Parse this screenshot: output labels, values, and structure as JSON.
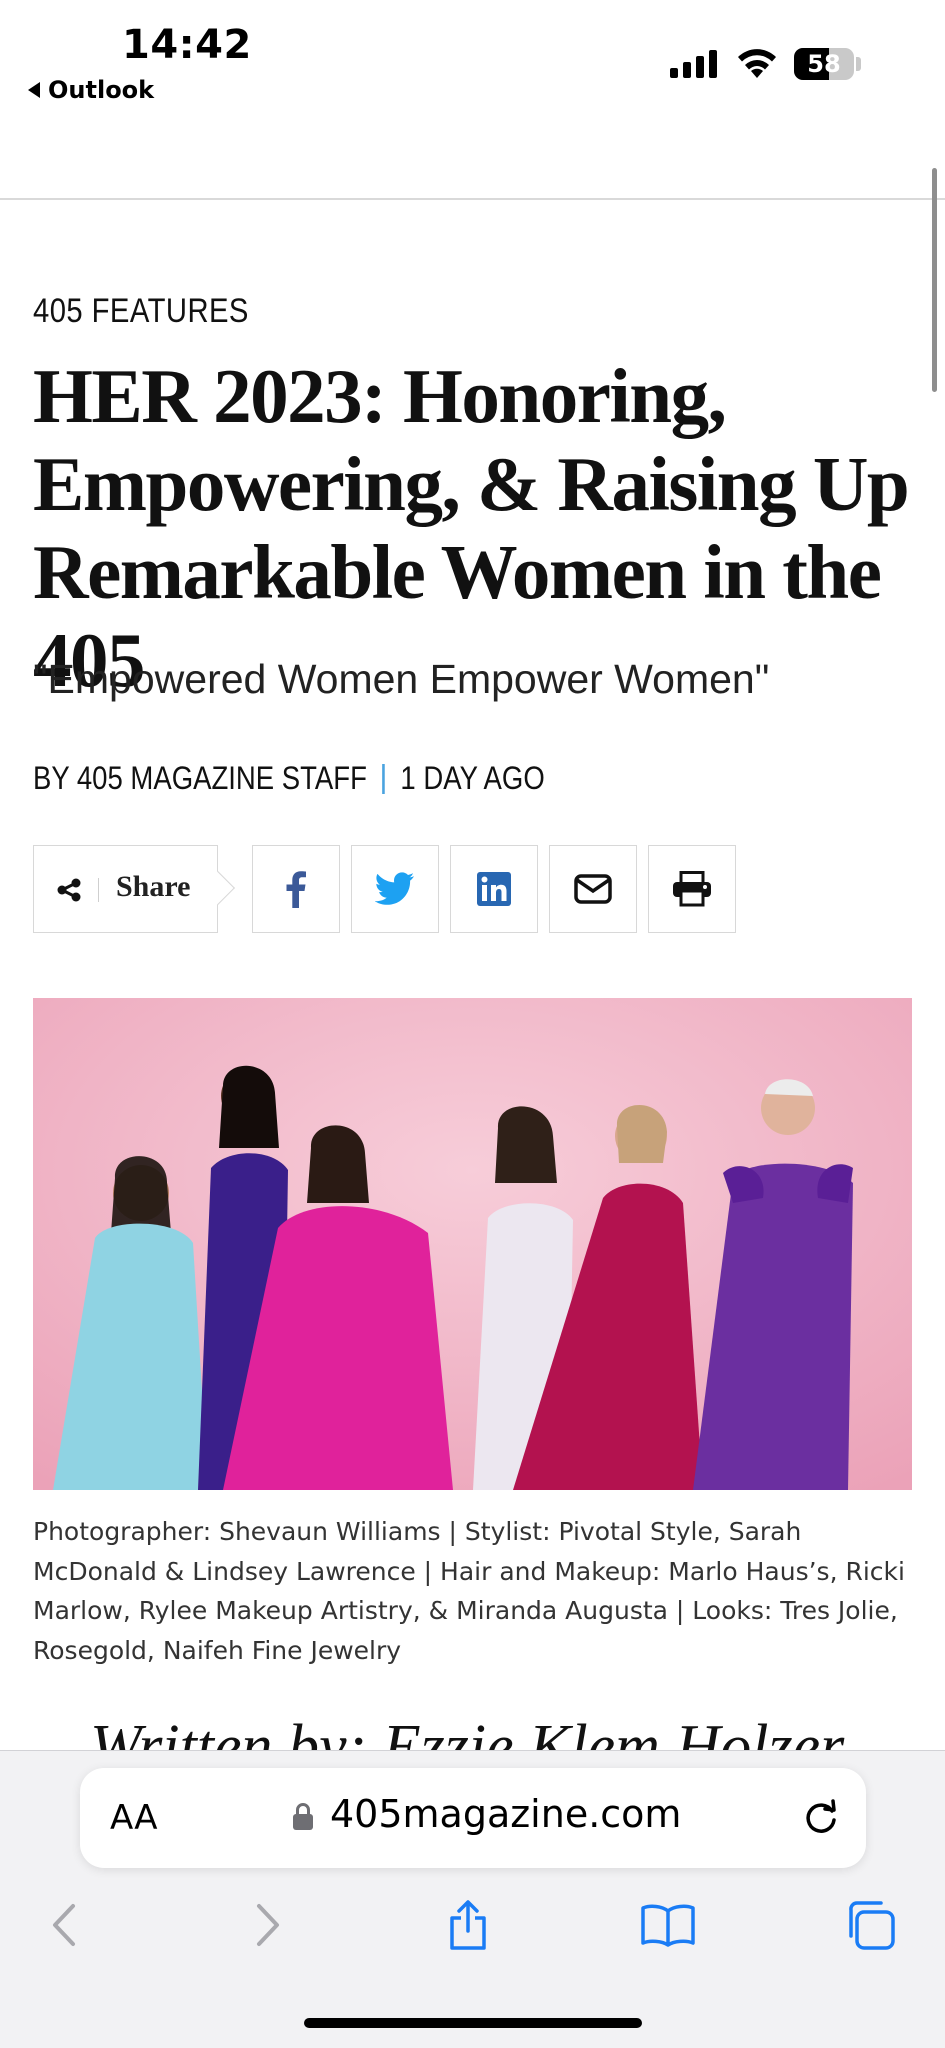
{
  "status_bar": {
    "time": "14:42",
    "back_app": "Outlook",
    "battery_percent": "58",
    "battery_level": 0.58
  },
  "article": {
    "category": "405 FEATURES",
    "headline_lines": [
      "HER 2023: Honoring,",
      "Empowering, & Raising Up",
      "Remarkable Women in the 405"
    ],
    "subtitle": "\"Empowered Women Empower Women\"",
    "byline": "BY 405 MAGAZINE STAFF",
    "date": "1 DAY AGO",
    "caption": "Photographer: Shevaun Williams | Stylist: Pivotal Style, Sarah McDonald & Lindsey Lawrence | Hair and Makeup: Marlo Haus’s, Ricki Marlow, Rylee Makeup Artistry, & Miranda Augusta | Looks: Tres Jolie, Rosegold, Naifeh Fine Jewelry",
    "written_by": "Written by: Ezzie Klem Holzer"
  },
  "share": {
    "label": "Share",
    "buttons": [
      {
        "name": "facebook",
        "icon": "facebook-icon",
        "color": "#3b5998"
      },
      {
        "name": "twitter",
        "icon": "twitter-icon",
        "color": "#1da1f2"
      },
      {
        "name": "linkedin",
        "icon": "linkedin-icon",
        "color": "#2867b2"
      },
      {
        "name": "email",
        "icon": "envelope-icon",
        "color": "#111111"
      },
      {
        "name": "print",
        "icon": "printer-icon",
        "color": "#111111"
      }
    ]
  },
  "browser": {
    "aa_label": "AA",
    "url": "405magazine.com",
    "toolbar": [
      "back-icon",
      "forward-icon",
      "share-icon",
      "bookmarks-icon",
      "tabs-icon"
    ],
    "accent": "#1a7cf5"
  },
  "colors": {
    "accent_blue": "#4aa3df",
    "photo_background": "#f2b4c6"
  }
}
